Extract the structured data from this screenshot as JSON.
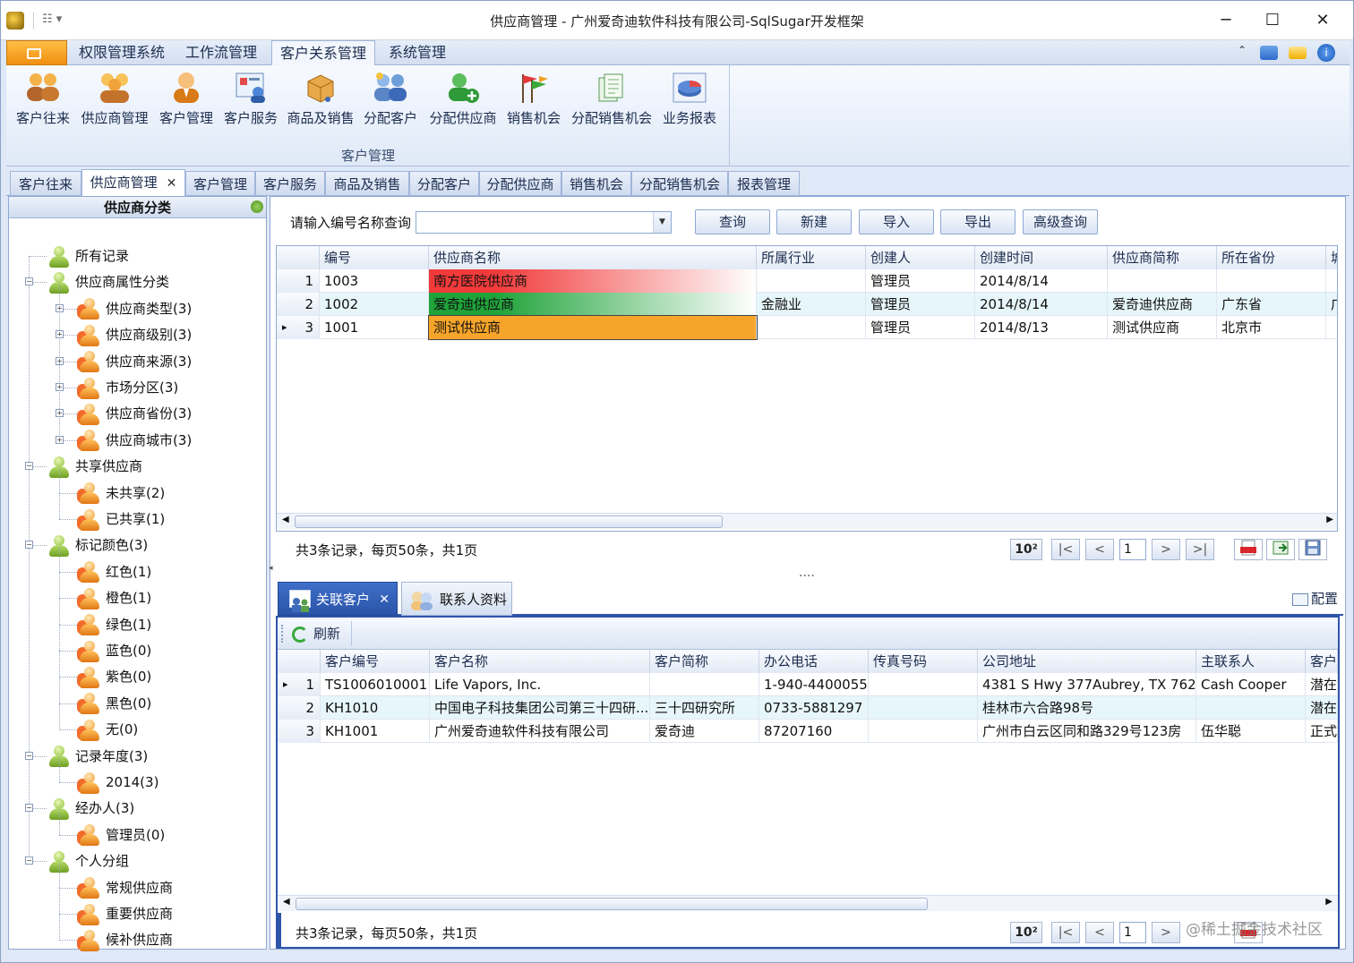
{
  "window": {
    "title": "供应商管理 - 广州爱奇迪软件科技有限公司-SqlSugar开发框架"
  },
  "ribbon_tabs": [
    "权限管理系统",
    "工作流管理",
    "客户关系管理",
    "系统管理"
  ],
  "ribbon_active_tab": "客户关系管理",
  "ribbon_group": {
    "label": "客户管理",
    "buttons": [
      "客户往来",
      "供应商管理",
      "客户管理",
      "客户服务",
      "商品及销售",
      "分配客户",
      "分配供应商",
      "销售机会",
      "分配销售机会",
      "业务报表"
    ]
  },
  "doc_tabs": [
    "客户往来",
    "供应商管理",
    "客户管理",
    "客户服务",
    "商品及销售",
    "分配客户",
    "分配供应商",
    "销售机会",
    "分配销售机会",
    "报表管理"
  ],
  "doc_tab_active": "供应商管理",
  "left_panel": {
    "title": "供应商分类",
    "tree": [
      {
        "label": "所有记录"
      },
      {
        "label": "供应商属性分类"
      },
      {
        "label": "供应商类型(3)"
      },
      {
        "label": "供应商级别(3)"
      },
      {
        "label": "供应商来源(3)"
      },
      {
        "label": "市场分区(3)"
      },
      {
        "label": "供应商省份(3)"
      },
      {
        "label": "供应商城市(3)"
      },
      {
        "label": "共享供应商"
      },
      {
        "label": "未共享(2)"
      },
      {
        "label": "已共享(1)"
      },
      {
        "label": "标记颜色(3)"
      },
      {
        "label": "红色(1)"
      },
      {
        "label": "橙色(1)"
      },
      {
        "label": "绿色(1)"
      },
      {
        "label": "蓝色(0)"
      },
      {
        "label": "紫色(0)"
      },
      {
        "label": "黑色(0)"
      },
      {
        "label": "无(0)"
      },
      {
        "label": "记录年度(3)"
      },
      {
        "label": "2014(3)"
      },
      {
        "label": "经办人(3)"
      },
      {
        "label": "管理员(0)"
      },
      {
        "label": "个人分组"
      },
      {
        "label": "常规供应商"
      },
      {
        "label": "重要供应商"
      },
      {
        "label": "候补供应商"
      }
    ]
  },
  "search": {
    "label": "请输入编号名称查询",
    "value": ""
  },
  "search_buttons": [
    "查询",
    "新建",
    "导入",
    "导出",
    "高级查询"
  ],
  "supplier_grid": {
    "columns": [
      "编号",
      "供应商名称",
      "所属行业",
      "创建人",
      "创建时间",
      "供应商简称",
      "所在省份",
      "城"
    ],
    "rows": [
      {
        "n": "1",
        "cells": [
          "1003",
          "南方医院供应商",
          "",
          "管理员",
          "2014/8/14",
          "",
          "",
          ""
        ]
      },
      {
        "n": "2",
        "cells": [
          "1002",
          "爱奇迪供应商",
          "金融业",
          "管理员",
          "2014/8/14",
          "爱奇迪供应商",
          "广东省",
          "广"
        ]
      },
      {
        "n": "3",
        "cells": [
          "1001",
          "测试供应商",
          "",
          "管理员",
          "2014/8/13",
          "测试供应商",
          "北京市",
          ""
        ]
      }
    ],
    "row_colors": [
      "#f23a3a",
      "#1fa33a",
      "#f7a52a"
    ],
    "current_row_marker": "▸"
  },
  "pager_top": {
    "summary": "共3条记录，每页50条，共1页",
    "page": "1",
    "size_btn": "10²"
  },
  "splitter_dots": "....",
  "bottom_tabs": [
    "关联客户",
    "联系人资料"
  ],
  "bottom_config_label": "配置",
  "refresh_label": "刷新",
  "customer_grid": {
    "columns": [
      "客户编号",
      "客户名称",
      "客户简称",
      "办公电话",
      "传真号码",
      "公司地址",
      "主联系人",
      "客户"
    ],
    "rows": [
      {
        "n": "1",
        "cells": [
          "TS1006010001",
          "Life Vapors, Inc.",
          "",
          "1-940-4400055",
          "",
          "4381 S Hwy 377Aubrey, TX 762...",
          "Cash Cooper",
          "潜在"
        ]
      },
      {
        "n": "2",
        "cells": [
          "KH1010",
          "中国电子科技集团公司第三十四研...",
          "三十四研究所",
          "0733-5881297",
          "",
          "桂林市六合路98号",
          "",
          "潜在"
        ]
      },
      {
        "n": "3",
        "cells": [
          "KH1001",
          "广州爱奇迪软件科技有限公司",
          "爱奇迪",
          "87207160",
          "",
          "广州市白云区同和路329号123房",
          "伍华聪",
          "正式"
        ]
      }
    ]
  },
  "pager_bottom": {
    "summary": "共3条记录，每页50条，共1页",
    "page": "1",
    "size_btn": "10²"
  },
  "watermark": "@稀土掘金技术社区"
}
